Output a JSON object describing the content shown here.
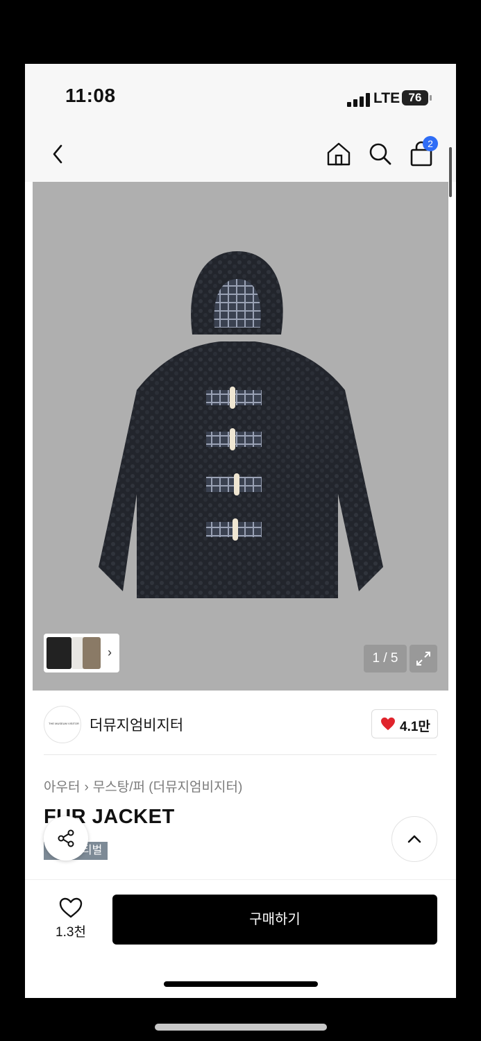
{
  "status_bar": {
    "time": "11:08",
    "network": "LTE",
    "battery": "76"
  },
  "nav": {
    "back_icon": "chevron-left-icon",
    "home_icon": "home-icon",
    "search_icon": "search-icon",
    "bag_icon": "shopping-bag-icon",
    "cart_count": "2",
    "badge_color": "#2f6df6"
  },
  "gallery": {
    "page_indicator": "1 / 5",
    "expand_icon": "expand-icon",
    "thumb_more_icon": "chevron-right-icon",
    "background_color": "#afafaf"
  },
  "brand": {
    "logo_text": "THE MUSEUM VISITOR",
    "name": "더뮤지엄비지터",
    "like_count": "4.1만",
    "heart_color": "#e0242c"
  },
  "product": {
    "breadcrumb": [
      "아우터",
      "무스탕/퍼 (더뮤지엄비지터)"
    ],
    "title": "FUR JACKET",
    "tag": "스티벌"
  },
  "actions": {
    "share_icon": "share-icon",
    "scroll_top_icon": "chevron-up-icon",
    "wish_icon": "heart-outline-icon",
    "wish_count": "1.3천",
    "buy_label": "구매하기"
  }
}
